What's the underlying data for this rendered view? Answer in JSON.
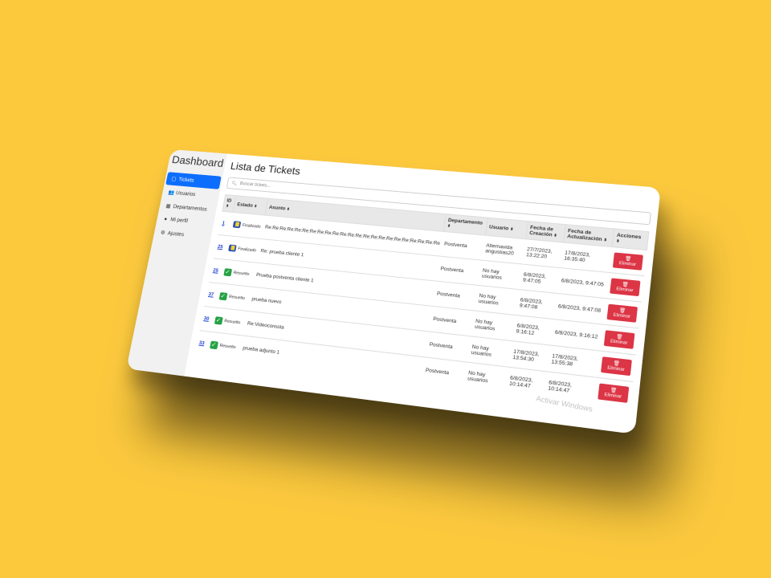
{
  "brand": "Dashboard",
  "sidebar": {
    "items": [
      {
        "icon": "ticket-icon",
        "glyph": "▢",
        "label": "Tickets",
        "active": true
      },
      {
        "icon": "users-icon",
        "glyph": "👥",
        "label": "Usuarios"
      },
      {
        "icon": "building-icon",
        "glyph": "▦",
        "label": "Departamentos"
      },
      {
        "icon": "user-circle-icon",
        "glyph": "●",
        "label": "Mi perfil"
      },
      {
        "icon": "gear-icon",
        "glyph": "⚙",
        "label": "Ajustes"
      }
    ]
  },
  "main": {
    "title": "Lista de Tickets",
    "search_placeholder": "Buscar tickets...",
    "columns": [
      "ID",
      "Estado",
      "Asunto",
      "Departamento",
      "Usuario",
      "Fecha de Creación",
      "Fecha de Actualización",
      "Acciones"
    ],
    "rows": [
      {
        "id": "1",
        "estado": "Finalizado",
        "estado_icon": "new",
        "asunto": "Re:Re:Re:Re:Re:Re:Re:Re:Re:Re:Re:Re:Re:Re:Re:Re:Re:Re:Re:Re:Re:Re:Re:Re:Re:Re:Re:",
        "departamento": "Postventa",
        "usuario": "Alternavida angustias20",
        "creacion": "27/7/2023, 13:22:20",
        "actualizacion": "17/8/2023, 16:35:40"
      },
      {
        "id": "25",
        "estado": "Finalizado",
        "estado_icon": "new",
        "asunto": "Re: prueba cliente 1",
        "departamento": "Postventa",
        "usuario": "No hay usuarios",
        "creacion": "6/8/2023, 9:47:05",
        "actualizacion": "6/8/2023, 9:47:05"
      },
      {
        "id": "25",
        "estado": "Resuelto",
        "estado_icon": "check",
        "asunto": "Prueba postventa cliente 1",
        "departamento": "Postventa",
        "usuario": "No hay usuarios",
        "creacion": "6/8/2023, 9:47:08",
        "actualizacion": "6/8/2023, 9:47:08"
      },
      {
        "id": "37",
        "estado": "Resuelto",
        "estado_icon": "check",
        "asunto": "prueba nuevo",
        "departamento": "Postventa",
        "usuario": "No hay usuarios",
        "creacion": "6/8/2023, 9:16:12",
        "actualizacion": "6/8/2023, 9:16:12"
      },
      {
        "id": "30",
        "estado": "Resuelto",
        "estado_icon": "check",
        "asunto": "Re:Videoconsola",
        "departamento": "Postventa",
        "usuario": "No hay usuarios",
        "creacion": "17/8/2023, 13:54:30",
        "actualizacion": "17/8/2023, 13:55:38"
      },
      {
        "id": "33",
        "estado": "Resuelto",
        "estado_icon": "check",
        "asunto": "prueba adjunto 1",
        "departamento": "Postventa",
        "usuario": "No hay usuarios",
        "creacion": "6/8/2023, 10:14:47",
        "actualizacion": "6/8/2023, 10:14:47"
      }
    ],
    "delete_label": "Eliminar"
  },
  "watermark": "Activar Windows"
}
